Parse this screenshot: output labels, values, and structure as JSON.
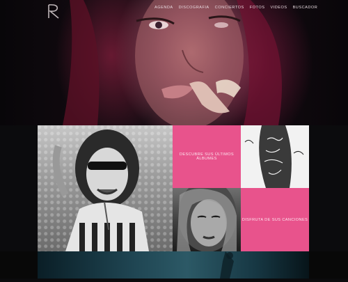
{
  "header": {
    "logo_icon": "rihanna-r-logo-icon",
    "nav": [
      {
        "label": "AGENDA"
      },
      {
        "label": "DISCOGRAFIA"
      },
      {
        "label": "CONCIERTOS"
      },
      {
        "label": "FOTOS"
      },
      {
        "label": "VIDEOS"
      },
      {
        "label": "BUSCADOR"
      }
    ]
  },
  "tiles": {
    "albums_caption": "DESCUBRE SUS ÚLTIMOS ÁLBUMES",
    "songs_caption": "DISFRUTA DE SUS CANCIONES"
  },
  "colors": {
    "accent_pink": "#e8538c",
    "background": "#0b0b0d"
  }
}
